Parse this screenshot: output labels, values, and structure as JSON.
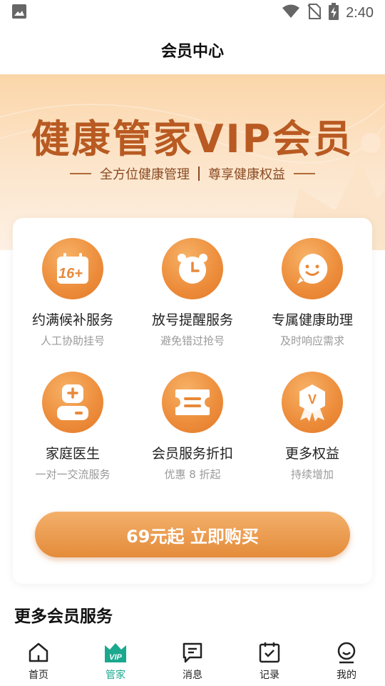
{
  "status_bar": {
    "time": "2:40"
  },
  "header": {
    "title": "会员中心"
  },
  "banner": {
    "title": "健康管家VIP会员",
    "subtitle_left": "全方位健康管理",
    "subtitle_right": "尊享健康权益"
  },
  "features": [
    {
      "title": "约满候补服务",
      "desc": "人工协助挂号",
      "badge": "16+"
    },
    {
      "title": "放号提醒服务",
      "desc": "避免错过抢号"
    },
    {
      "title": "专属健康助理",
      "desc": "及时响应需求"
    },
    {
      "title": "家庭医生",
      "desc": "一对一交流服务"
    },
    {
      "title": "会员服务折扣",
      "desc": "优惠 8 折起"
    },
    {
      "title": "更多权益",
      "desc": "持续增加",
      "badge": "V"
    }
  ],
  "buy_button": {
    "label": "69元起 立即购买"
  },
  "more_section": {
    "title": "更多会员服务"
  },
  "tab_bar": {
    "items": [
      {
        "label": "首页"
      },
      {
        "label": "管家",
        "badge": "VIP"
      },
      {
        "label": "消息"
      },
      {
        "label": "记录"
      },
      {
        "label": "我的"
      }
    ],
    "active_color": "#1aa88e"
  },
  "colors": {
    "accent": "#e8893a",
    "banner_title": "#b85a22"
  }
}
